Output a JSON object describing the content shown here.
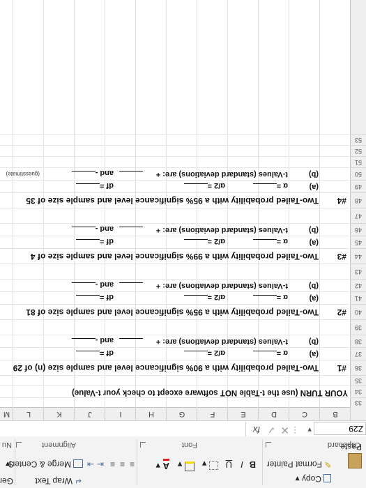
{
  "clipboard": {
    "paste": "Paste",
    "copy": "Copy",
    "format_painter": "Format Painter",
    "group": "Clipboard"
  },
  "font": {
    "bold": "B",
    "italic": "I",
    "underline": "U",
    "font_color": "A",
    "group": "Font"
  },
  "alignment": {
    "wrap_text": "Wrap Text",
    "merge_center": "Merge & Center",
    "group": "Alignment"
  },
  "number": {
    "format": "General",
    "currency": "$",
    "percent": "%",
    "group": "Nu"
  },
  "formula_bar": {
    "name_box": "Z29",
    "fx": "fx"
  },
  "columns": [
    "B",
    "C",
    "D",
    "E",
    "F",
    "G",
    "H",
    "I",
    "J",
    "K",
    "L",
    "M"
  ],
  "rows": [
    "33",
    "34",
    "35",
    "36",
    "37",
    "38",
    "39",
    "40",
    "41",
    "42",
    "43",
    "44",
    "45",
    "46",
    "47",
    "48",
    "49",
    "50",
    "51",
    "52",
    "53"
  ],
  "sheet": {
    "heading": "YOUR TURN (use the t-Table NOT software except to check your t-Value)",
    "problems": [
      {
        "num": "#1",
        "title": "Two-Tailed probability with a 90% significance level and sample size (n) of 29",
        "alpha": "α =",
        "alpha2": "α/2 =",
        "df": "df =",
        "tvals": "t-Values (standard deviations) are: +",
        "and": "and -",
        "a": "(a)",
        "b": "(b)"
      },
      {
        "num": "#2",
        "title": "Two-Tailed probability with a 95% significance level and sample size of 81",
        "alpha": "α =",
        "alpha2": "α/2 =",
        "df": "df =",
        "tvals": "t-Values (standard deviations) are: +",
        "and": "and -",
        "a": "(a)",
        "b": "(b)"
      },
      {
        "num": "#3",
        "title": "Two-Tailed probability with a 99% significance level and sample size of 4",
        "alpha": "α =",
        "alpha2": "α/2 =",
        "df": "df =",
        "tvals": "t-Values (standard deviations) are: +",
        "and": "and -",
        "a": "(a)",
        "b": "(b)"
      },
      {
        "num": "#4",
        "title": "Two-Tailed probability with a 95% significance level and sample size of 35",
        "alpha": "α =",
        "alpha2": "α/2 =",
        "df": "df =",
        "tvals": "t-Values (standard deviations) are: +",
        "and": "and -",
        "a": "(a)",
        "b": "(b)"
      }
    ],
    "guesstimate": "(guesstimate)"
  }
}
